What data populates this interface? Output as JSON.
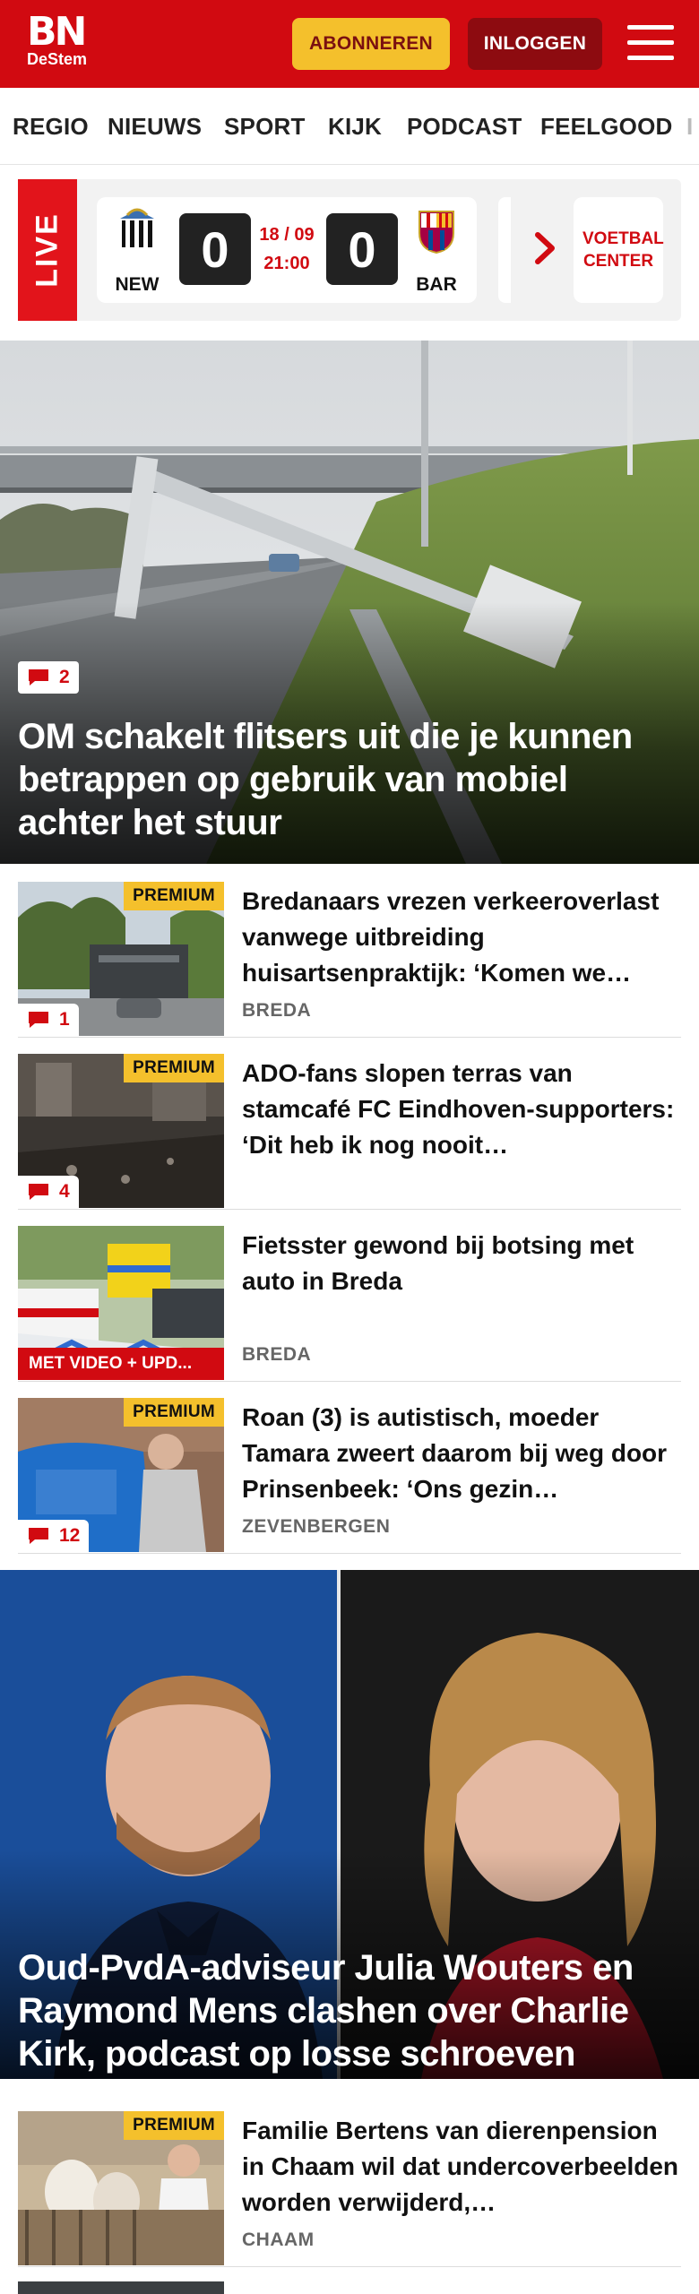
{
  "header": {
    "logo_main": "BN",
    "logo_sub": "DeStem",
    "subscribe_label": "ABONNEREN",
    "login_label": "INLOGGEN"
  },
  "nav": {
    "items": [
      "REGIO",
      "NIEUWS",
      "SPORT",
      "KIJK",
      "PODCAST",
      "FEELGOOD",
      "I"
    ]
  },
  "live": {
    "label": "LIVE",
    "home_team": "NEW",
    "away_team": "BAR",
    "home_score": "0",
    "away_score": "0",
    "date": "18 / 09",
    "time": "21:00",
    "voetbal_center": "VOETBAL CENTER"
  },
  "hero": {
    "title": "OM schakelt flitsers uit die je kunnen betrappen op gebruik van mobiel achter het stuur",
    "comments": "2"
  },
  "articles": [
    {
      "title": "Bredanaars vrezen verkeerover­last vanwege uitbreiding huisartsenpraktijk: ‘Komen we…",
      "location": "BREDA",
      "premium": "PREMIUM",
      "comments": "1"
    },
    {
      "title": "ADO-fans slopen terras van stamcafé FC Eindhoven-supporters: ‘Dit heb ik nog nooit…",
      "location": "",
      "premium": "PREMIUM",
      "comments": "4"
    },
    {
      "title": "Fietsster gewond bij botsing met auto in Breda",
      "location": "BREDA",
      "badge": "MET VIDEO + UPD..."
    },
    {
      "title": "Roan (3) is autistisch, moeder Tamara zweert daarom bij weg door Prinsenbeek: ‘Ons gezin…",
      "location": "ZEVENBERGEN",
      "premium": "PREMIUM",
      "comments": "12"
    }
  ],
  "hero2": {
    "title": "Oud-PvdA-adviseur Julia Wouters en Raymond Mens clashen over Charlie Kirk, podcast op losse schroeven"
  },
  "article_bottom": {
    "title": "Familie Bertens van dierenpensi­on in Chaam wil dat undercover­beelden worden verwijderd,…",
    "location": "CHAAM",
    "premium": "PREMIUM"
  },
  "colors": {
    "brand_red": "#d10a11",
    "premium_yellow": "#f4c02c",
    "login_dark_red": "#8d0b10"
  }
}
